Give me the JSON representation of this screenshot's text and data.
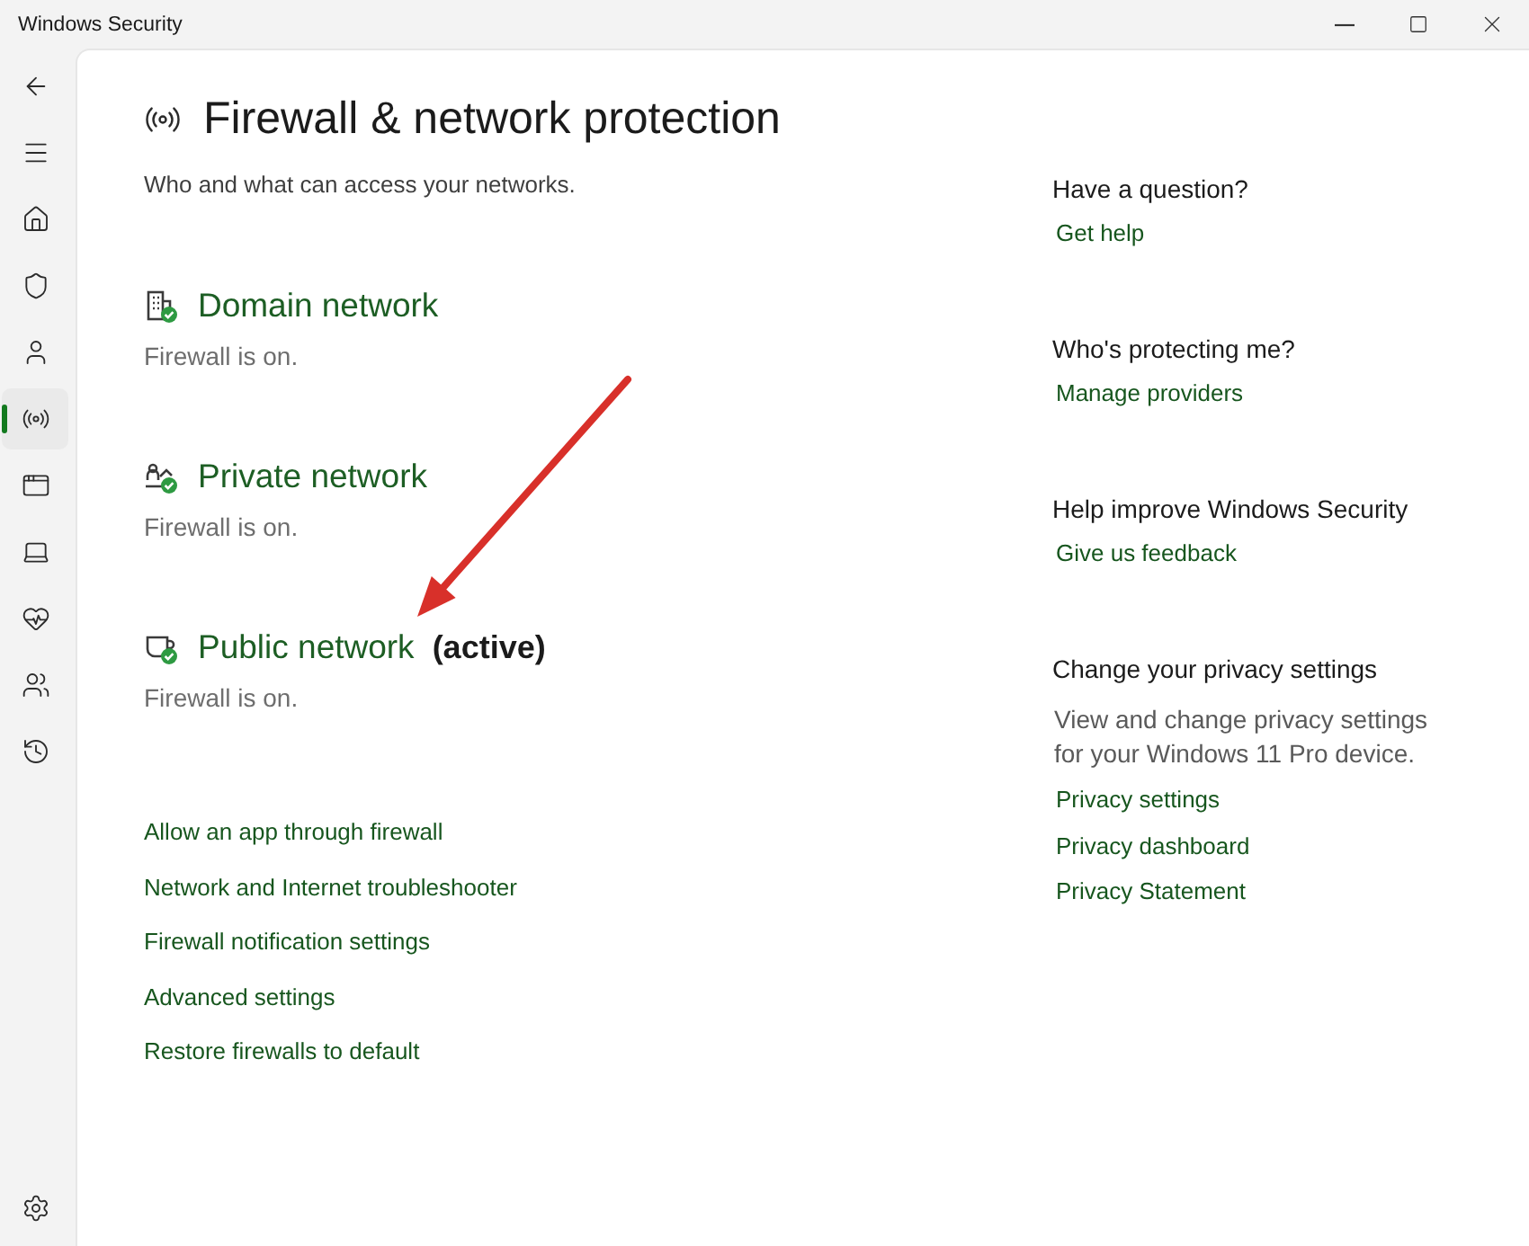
{
  "window": {
    "title": "Windows Security"
  },
  "sidebar": {
    "top": [
      {
        "kind": "back"
      },
      {
        "kind": "menu"
      }
    ],
    "items": [
      {
        "kind": "home",
        "selected": false
      },
      {
        "kind": "shield",
        "selected": false
      },
      {
        "kind": "account",
        "selected": false
      },
      {
        "kind": "network",
        "selected": true
      },
      {
        "kind": "app",
        "selected": false
      },
      {
        "kind": "device",
        "selected": false
      },
      {
        "kind": "health",
        "selected": false
      },
      {
        "kind": "family",
        "selected": false
      },
      {
        "kind": "history",
        "selected": false
      }
    ],
    "bottom": [
      {
        "kind": "settings",
        "selected": false
      }
    ]
  },
  "page": {
    "title": "Firewall & network protection",
    "subtitle": "Who and what can access your networks."
  },
  "networks": [
    {
      "kind": "domain",
      "name": "Domain network",
      "status": "Firewall is on."
    },
    {
      "kind": "private",
      "name": "Private network",
      "status": "Firewall is on."
    },
    {
      "kind": "public",
      "name": "Public network",
      "note": "(active)",
      "status": "Firewall is on."
    }
  ],
  "links": [
    "Allow an app through firewall",
    "Network and Internet troubleshooter",
    "Firewall notification settings",
    "Advanced settings",
    "Restore firewalls to default"
  ],
  "side_panel": {
    "sections": [
      {
        "heading": "Have a question?",
        "links": [
          "Get help"
        ]
      },
      {
        "heading": "Who's protecting me?",
        "links": [
          "Manage providers"
        ]
      },
      {
        "heading": "Help improve Windows Security",
        "links": [
          "Give us feedback"
        ]
      },
      {
        "heading": "Change your privacy settings",
        "description": "View and change privacy settings for your Windows 11 Pro device.",
        "links": [
          "Privacy settings",
          "Privacy dashboard",
          "Privacy Statement"
        ]
      }
    ]
  }
}
